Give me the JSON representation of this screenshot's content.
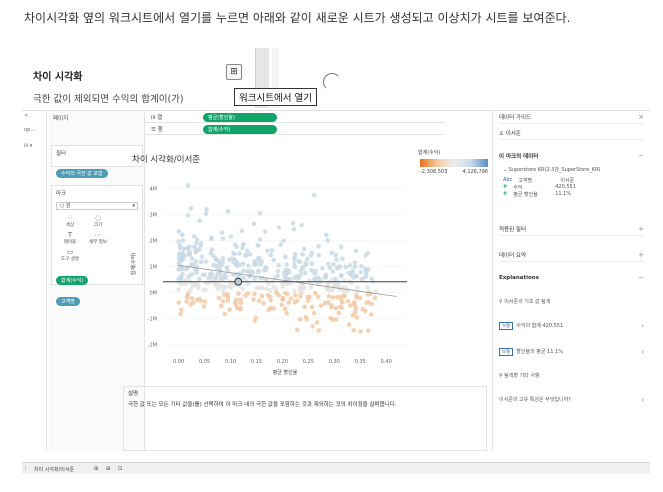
{
  "caption": "차이시각화 옆의 워크시트에서 열기를 누르면 아래와 같이 새로운 시트가 생성되고 이상치가 시트를 보여준다.",
  "snippet": {
    "title": "차이 시각화",
    "subtitle": "극한 값이 제외되면 수익의 합계이(가)",
    "tooltip": "워크시트에서 열기"
  },
  "left_strip": {
    "item1": "up...",
    "item2": "iii ▾",
    "arrow": "<"
  },
  "pages": {
    "label": "페이지"
  },
  "filters": {
    "label": "필터",
    "pill": "수익의 극한 값 포함"
  },
  "marks": {
    "label": "마크",
    "type": "원",
    "buttons": [
      {
        "label": "색상",
        "icon": "⁘"
      },
      {
        "label": "크기",
        "icon": "◌"
      },
      {
        "label": "레이블",
        "icon": "T"
      },
      {
        "label": "세부 정보",
        "icon": "⋯"
      },
      {
        "label": "도구 설명",
        "icon": "▭"
      }
    ],
    "pills": [
      "합계(수익)",
      "고객명"
    ]
  },
  "shelves": {
    "columns_label": "iii 열",
    "columns_pill": "평균(할인율)",
    "rows_label": "☰ 행",
    "rows_pill": "합계(수익)"
  },
  "viz": {
    "title": "차이 시각화/이서준"
  },
  "chart_data": {
    "type": "scatter",
    "title": "차이 시각화/이서준",
    "xlabel": "평균 할인율",
    "ylabel": "합계(수익)",
    "xticks": [
      "0.00",
      "0.05",
      "0.10",
      "0.15",
      "0.20",
      "0.25",
      "0.30",
      "0.35",
      "0.40"
    ],
    "yticks": [
      "4M",
      "3M",
      "2M",
      "1M",
      "0M",
      "-1M",
      "-2M"
    ],
    "xlim": [
      -0.03,
      0.44
    ],
    "ylim": [
      -2.4,
      4.6
    ],
    "highlight_point": {
      "x": 0.115,
      "y": 0.42
    },
    "reference_line_y": 0.42,
    "trend_line": [
      {
        "x": 0.0,
        "y": 1.05
      },
      {
        "x": 0.42,
        "y": -0.15
      }
    ]
  },
  "legend": {
    "title": "합계(수익)",
    "min": "-2,308,503",
    "max": "4,126,796"
  },
  "description": {
    "title": "설명",
    "text": "극한 값 또는 모든 기타 값을(를) 선택하여 이 마크 내의 극한 값을 포함하는 것과 제외하는 것의 차이점을 살펴봅니다."
  },
  "guide": {
    "header": "데이터 가이드",
    "close": "×",
    "person": "이서준",
    "mark_data_label": "이 마크의 데이터",
    "source": "Superstore KR(2.3강_SuperStore_KR)",
    "field1_k": "고객명",
    "field1_v": "이서준",
    "field2_k": "수익",
    "field2_v": "420,551",
    "field3_k": "평균 할인율",
    "field3_v": "11.1%",
    "filters_label": "적용된 필터",
    "summary_label": "데이터 요약",
    "explanations_label": "Explanations",
    "exp_base": "이서준의 기초 값 탐색",
    "exp_tag": "보통",
    "exp_item1": "수익의 합계 420,551",
    "exp_item2": "할인율의 평균 11.1%",
    "other_link": "탐색할 기타 사항",
    "unique_link": "이서준의 고유 특성은 무엇입니까?"
  },
  "tabbar": {
    "tab": "차이 시각화/이서준"
  }
}
